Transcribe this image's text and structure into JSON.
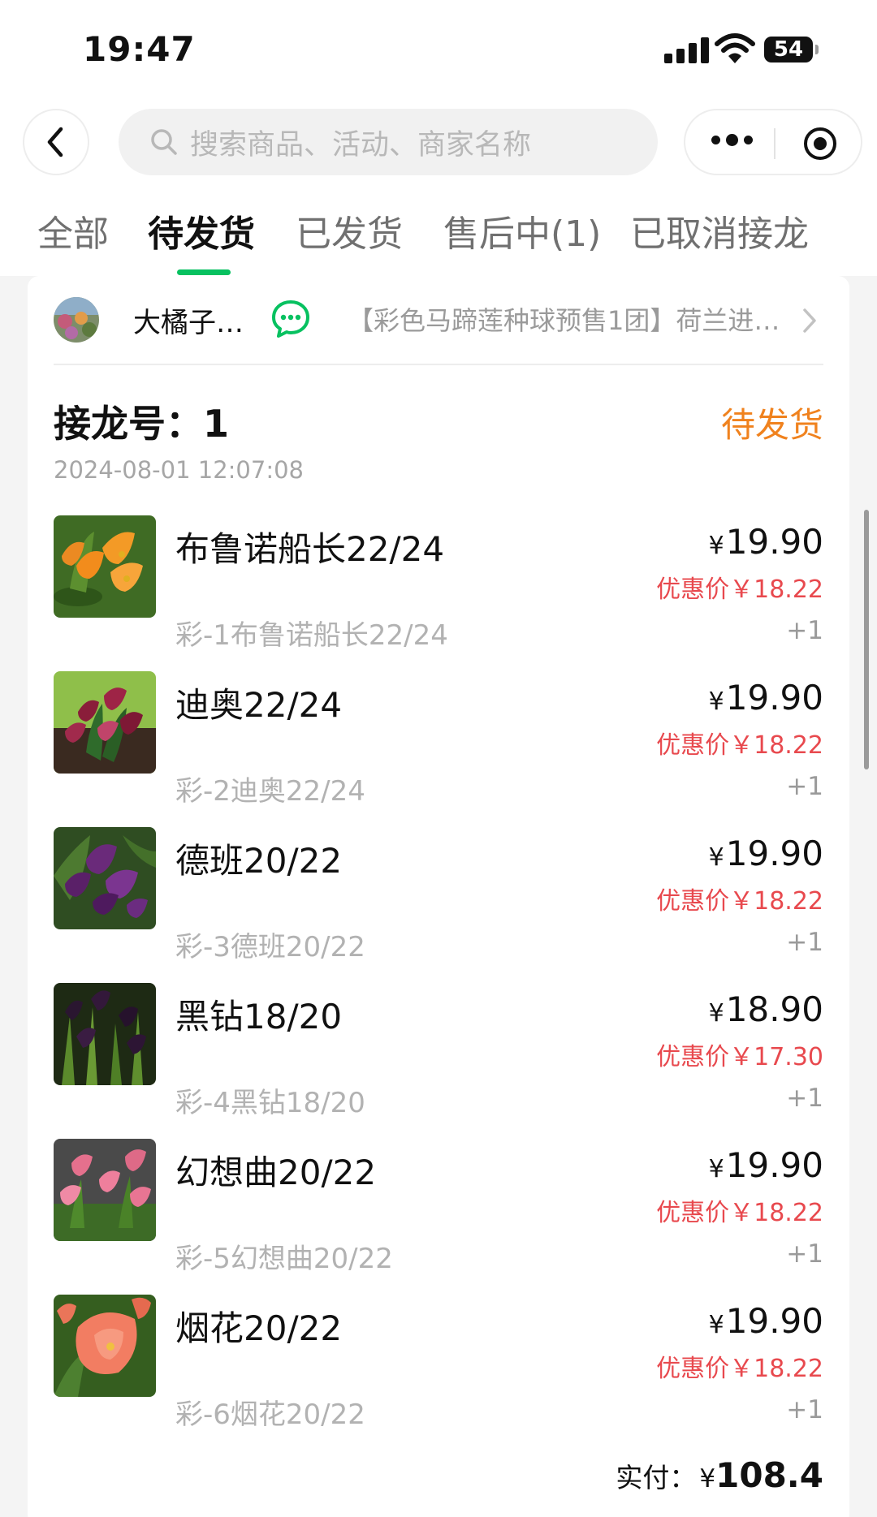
{
  "status_bar": {
    "time": "19:47",
    "battery": "54",
    "icons": [
      "cellular-signal-icon",
      "wifi-icon",
      "battery-icon"
    ]
  },
  "nav": {
    "back_icon": "chevron-left-icon",
    "search_placeholder": "搜索商品、活动、商家名称",
    "search_icon": "search-icon",
    "more_icon": "more-dots-icon",
    "close_icon": "target-icon"
  },
  "tabs": [
    {
      "label": "全部",
      "active": false
    },
    {
      "label": "待发货",
      "active": true
    },
    {
      "label": "已发货",
      "active": false
    },
    {
      "label": "售后中(1)",
      "active": false
    },
    {
      "label": "已取消接龙",
      "active": false
    }
  ],
  "accent_color": "#07c160",
  "order": {
    "shop_name": "大橘子…",
    "chat_icon": "chat-bubble-icon",
    "activity_title": "【彩色马蹄莲种球预售1团】荷兰进…",
    "jielong_label": "接龙号：1",
    "status": "待发货",
    "status_color": "#f0821e",
    "datetime": "2024-08-01 12:07:08",
    "currency": "¥",
    "items": [
      {
        "name": "布鲁诺船长22/24",
        "spec": "彩-1布鲁诺船长22/24",
        "price": "19.90",
        "discount": "优惠价￥18.22",
        "qty": "+1",
        "image": "orange calla lily"
      },
      {
        "name": "迪奥22/24",
        "spec": "彩-2迪奥22/24",
        "price": "19.90",
        "discount": "优惠价￥18.22",
        "qty": "+1",
        "image": "burgundy calla lily"
      },
      {
        "name": "德班20/22",
        "spec": "彩-3德班20/22",
        "price": "19.90",
        "discount": "优惠价￥18.22",
        "qty": "+1",
        "image": "purple calla lily"
      },
      {
        "name": "黑钻18/20",
        "spec": "彩-4黑钻18/20",
        "price": "18.90",
        "discount": "优惠价￥17.30",
        "qty": "+1",
        "image": "black calla lily"
      },
      {
        "name": "幻想曲20/22",
        "spec": "彩-5幻想曲20/22",
        "price": "19.90",
        "discount": "优惠价￥18.22",
        "qty": "+1",
        "image": "pink calla lily"
      },
      {
        "name": "烟花20/22",
        "spec": "彩-6烟花20/22",
        "price": "19.90",
        "discount": "优惠价￥18.22",
        "qty": "+1",
        "image": "coral calla lily"
      }
    ],
    "total_label": "实付：",
    "total_amount": "108.4"
  }
}
